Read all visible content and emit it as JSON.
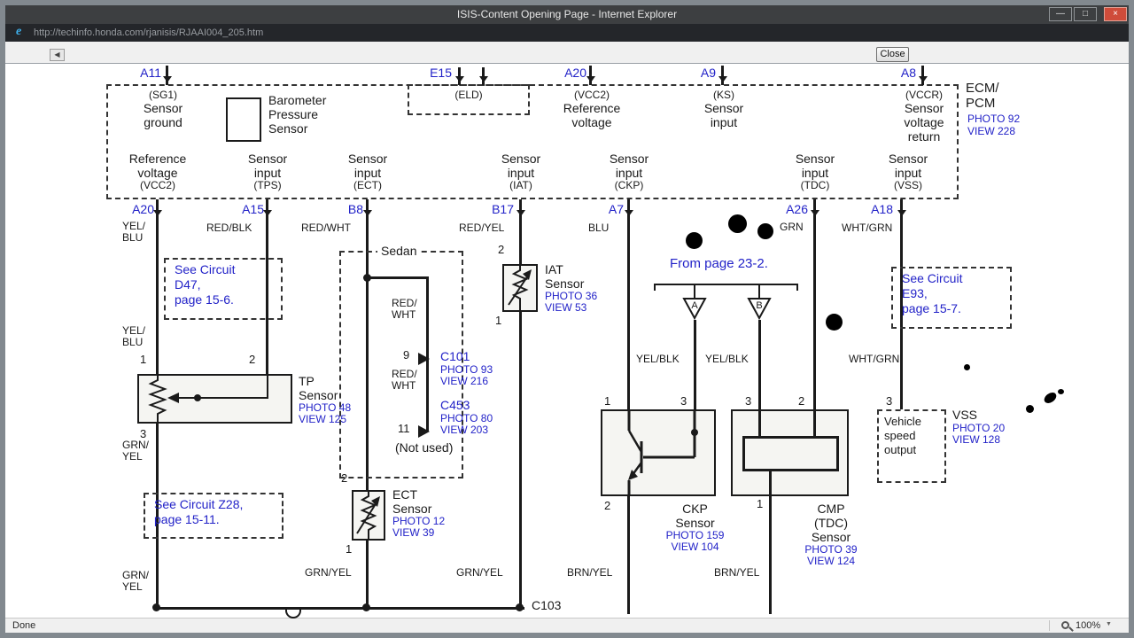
{
  "icons": {
    "ie_logo": "e",
    "back": "◀",
    "minimize": "—",
    "maximize": "□",
    "close_window": "×",
    "caret_down": "▼"
  },
  "chrome": {
    "title": "ISIS-Content Opening Page - Internet Explorer",
    "url": "http://techinfo.honda.com/rjanisis/RJAAI004_205.htm",
    "close_button": "Close",
    "status": "Done",
    "zoom_level": "100%"
  },
  "ecm": {
    "name1": "ECM/",
    "name2": "PCM",
    "photo": "PHOTO 92",
    "view": "VIEW 228",
    "top": {
      "a11": {
        "id": "A11",
        "code": "(SG1)",
        "l1": "Sensor",
        "l2": "ground"
      },
      "e15": {
        "id": "E15",
        "code": "(ELD)"
      },
      "baro": {
        "l1": "Barometer",
        "l2": "Pressure",
        "l3": "Sensor"
      },
      "a20": {
        "id": "A20",
        "code": "(VCC2)",
        "l1": "Reference",
        "l2": "voltage"
      },
      "a9": {
        "id": "A9",
        "code": "(KS)",
        "l1": "Sensor",
        "l2": "input"
      },
      "a8": {
        "id": "A8",
        "code": "(VCCR)",
        "l1": "Sensor",
        "l2": "voltage",
        "l3": "return"
      }
    },
    "bottom": {
      "vcc2": {
        "pin": "A20",
        "l1": "Reference",
        "l2": "voltage",
        "code": "(VCC2)"
      },
      "tps": {
        "pin": "A15",
        "l1": "Sensor",
        "l2": "input",
        "code": "(TPS)"
      },
      "ect": {
        "pin": "B8",
        "l1": "Sensor",
        "l2": "input",
        "code": "(ECT)"
      },
      "iat": {
        "pin": "B17",
        "l1": "Sensor",
        "l2": "input",
        "code": "(IAT)"
      },
      "ckp": {
        "pin": "A7",
        "l1": "Sensor",
        "l2": "input",
        "code": "(CKP)"
      },
      "tdc": {
        "pin": "A26",
        "l1": "Sensor",
        "l2": "input",
        "code": "(TDC)"
      },
      "vss": {
        "pin": "A18",
        "l1": "Sensor",
        "l2": "input",
        "code": "(VSS)"
      }
    }
  },
  "wire_colors": {
    "yel1": "YEL/",
    "yel2": "BLU",
    "red_blk": "RED/BLK",
    "red_wht": "RED/WHT",
    "red_yel": "RED/YEL",
    "blu": "BLU",
    "grn": "GRN",
    "wht_grn": "WHT/GRN",
    "red1": "RED/",
    "red2": "WHT",
    "yel_blk": "YEL/BLK",
    "grn1": "GRN/",
    "grn2": "YEL",
    "grn_yel": "GRN/YEL",
    "brn_yel": "BRN/YEL"
  },
  "sensors": {
    "tp": {
      "n1": "TP",
      "n2": "Sensor",
      "photo": "PHOTO 48",
      "view": "VIEW 125",
      "p1": "1",
      "p2": "2",
      "p3": "3"
    },
    "ect": {
      "n1": "ECT",
      "n2": "Sensor",
      "photo": "PHOTO 12",
      "view": "VIEW 39",
      "pt": "2",
      "pb": "1"
    },
    "iat": {
      "n1": "IAT",
      "n2": "Sensor",
      "photo": "PHOTO 36",
      "view": "VIEW 53",
      "pt": "2",
      "pb": "1"
    },
    "ckp": {
      "n1": "CKP",
      "n2": "Sensor",
      "photo": "PHOTO 159",
      "view": "VIEW 104",
      "p1": "1",
      "p3": "3",
      "p2": "2"
    },
    "cmp": {
      "n1": "CMP",
      "n2": "(TDC)",
      "n3": "Sensor",
      "photo": "PHOTO 39",
      "view": "VIEW 124",
      "p3": "3",
      "p2": "2",
      "p1": "1"
    },
    "vss": {
      "name": "VSS",
      "photo": "PHOTO 20",
      "view": "VIEW 128",
      "b1": "Vehicle",
      "b2": "speed",
      "b3": "output",
      "p3": "3"
    }
  },
  "notes": {
    "sedan": "Sedan",
    "from_page": "From page 23-2.",
    "branch_a": "A",
    "branch_b": "B",
    "d47": {
      "l1": "See Circuit",
      "l2": "D47,",
      "l3": "page 15-6."
    },
    "e93": {
      "l1": "See Circuit",
      "l2": "E93,",
      "l3": "page 15-7."
    },
    "z28": {
      "l1": "See Circuit Z28,",
      "l2": "page 15-11."
    },
    "c101": {
      "name": "C101",
      "photo": "PHOTO 93",
      "view": "VIEW 216",
      "pin": "9"
    },
    "c453": {
      "name": "C453",
      "photo": "PHOTO 80",
      "view": "VIEW 203",
      "pin": "11",
      "note": "(Not used)"
    },
    "c103": "C103"
  },
  "colors": {
    "link_blue": "#2222c8",
    "diagram_ink": "#1a1a1a"
  }
}
